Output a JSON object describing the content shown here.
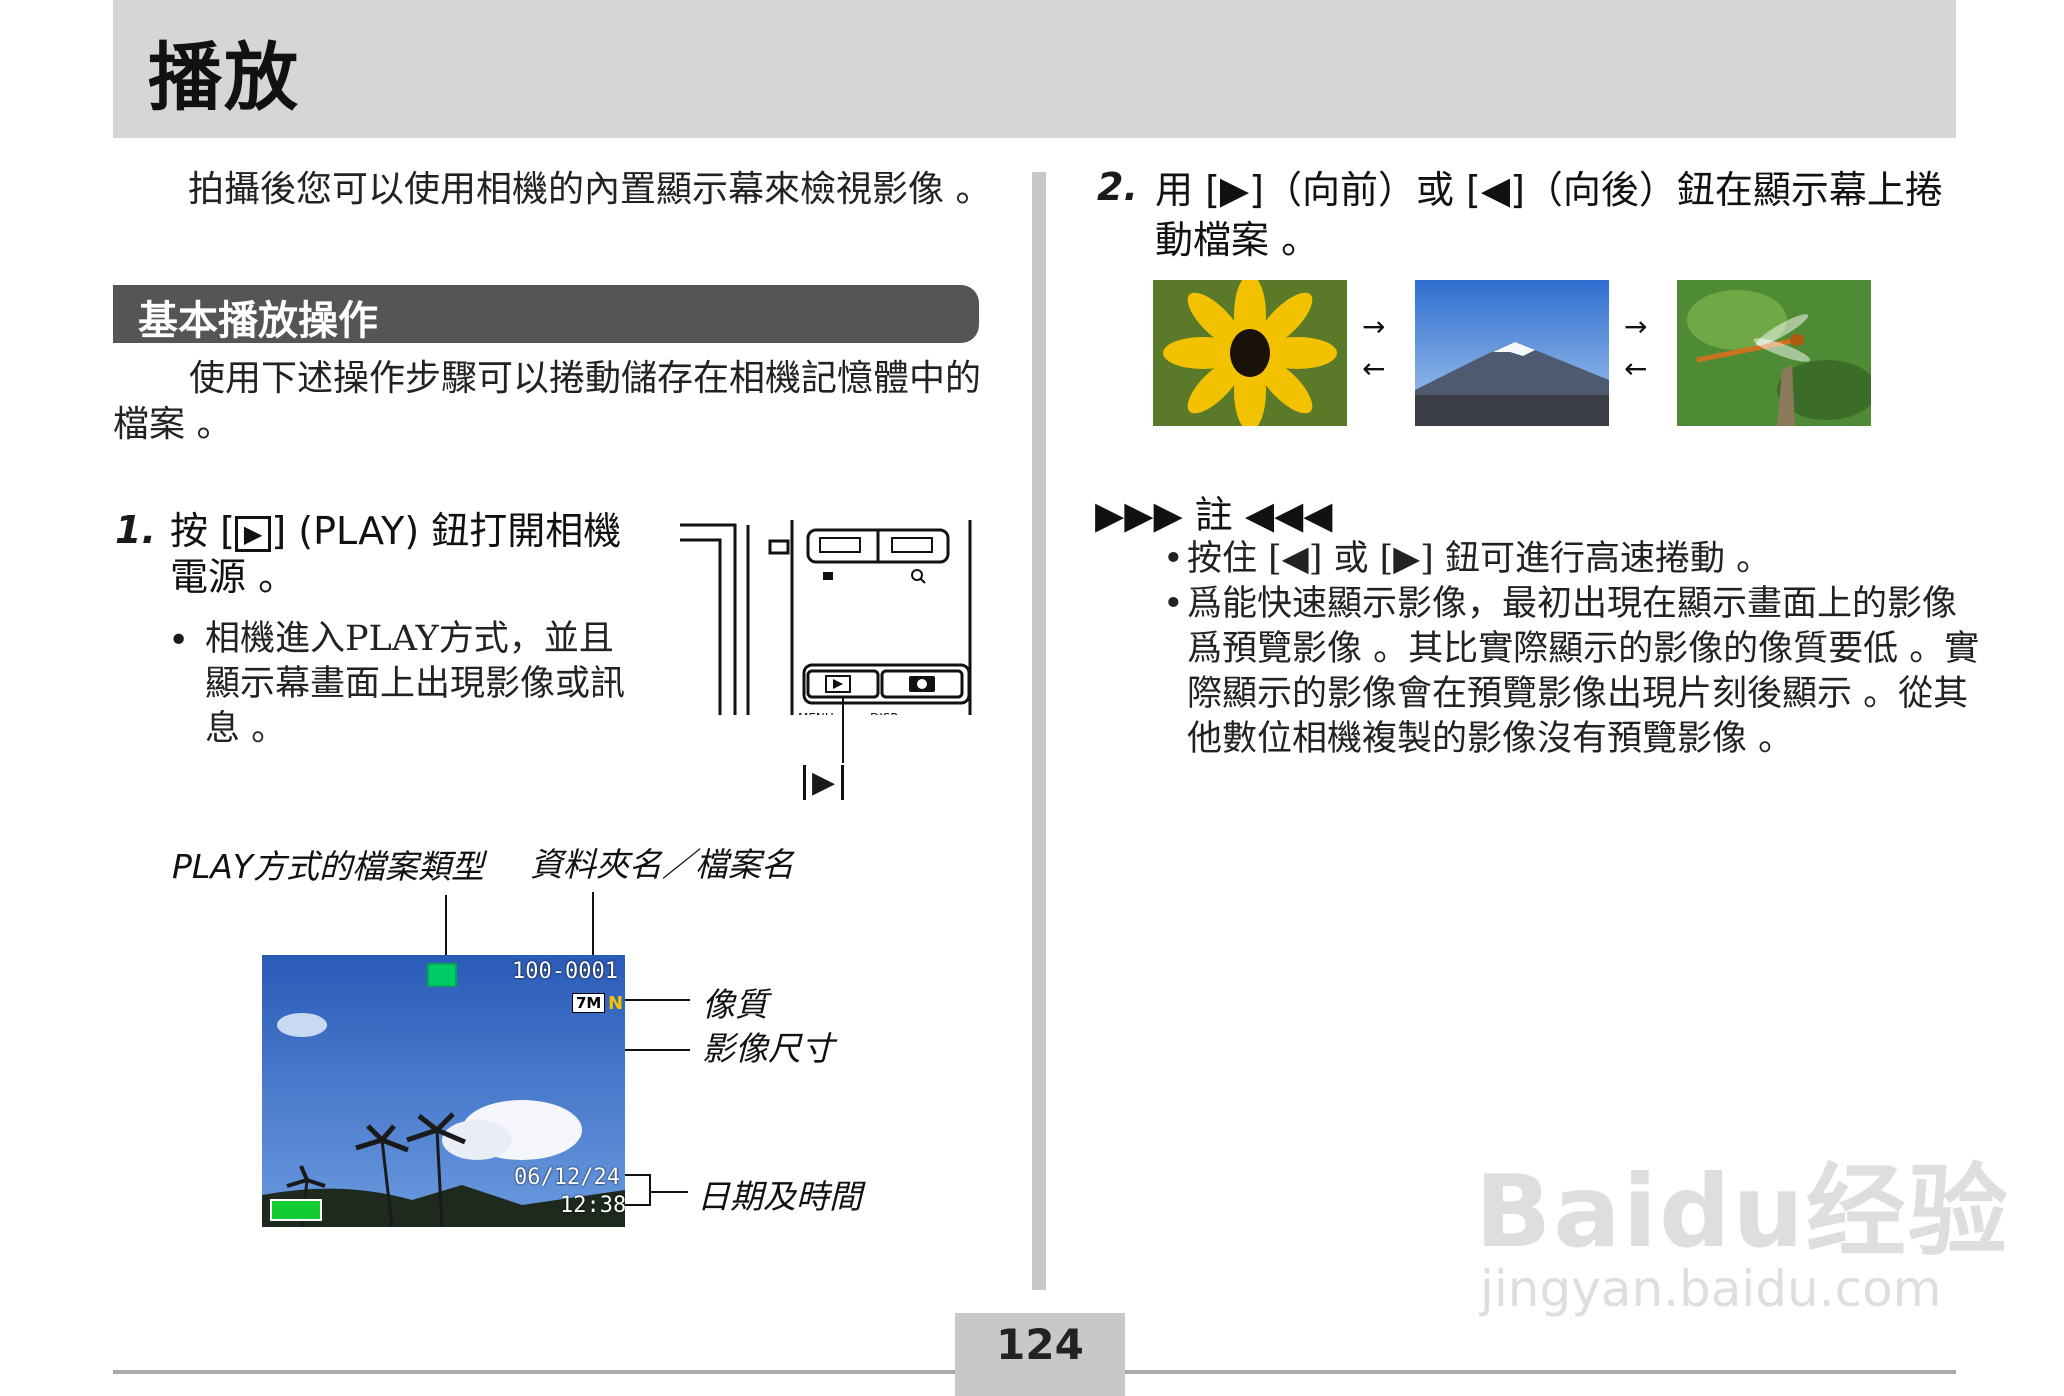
{
  "header": {
    "title": "播放"
  },
  "intro": "拍攝後您可以使用相機的內置顯示幕來檢視影像 。",
  "section": {
    "title": "基本播放操作",
    "description": "使用下述操作步驟可以捲動儲存在相機記憶體中的檔案 。"
  },
  "step1": {
    "number": "1.",
    "text_before": "按 [",
    "key_label": "▶",
    "text_after": "] (PLAY) 鈕打開相機電源 。",
    "bullet": "相機進入PLAY方式，並且顯示幕畫面上出現影像或訊息 。",
    "callout_label": "▶",
    "button_labels": [
      "MENU",
      "DISP"
    ]
  },
  "screen_diagram": {
    "label_file_type": "PLAY方式的檔案類型",
    "label_folder_file": "資料夾名／檔案名",
    "label_quality": "像質",
    "label_image_size": "影像尺寸",
    "label_datetime": "日期及時間",
    "lcd": {
      "file_name": "100-0001",
      "image_size": "7M",
      "quality": "N",
      "date": "06/12/24",
      "time": "12:38"
    }
  },
  "step2": {
    "number": "2.",
    "text": "用 [▶]（向前）或 [◀]（向後）鈕在顯示幕上捲動檔案 。",
    "arrow_forward": "→",
    "arrow_backward": "←"
  },
  "note": {
    "title": "註",
    "items": [
      "按住 [◀] 或 [▶] 鈕可進行高速捲動 。",
      "爲能快速顯示影像，最初出現在顯示畫面上的影像爲預覽影像 。其比實際顯示的影像的像質要低 。實際顯示的影像會在預覽影像出現片刻後顯示 。從其他數位相機複製的影像沒有預覽影像 。"
    ]
  },
  "watermark": {
    "logo": "Baidu经验",
    "url": "jingyan.baidu.com"
  },
  "footer": {
    "page_number": "124"
  },
  "colors": {
    "header_band": "#d6d6d6",
    "section_bar": "#555555",
    "divider": "#c8c8c8"
  }
}
